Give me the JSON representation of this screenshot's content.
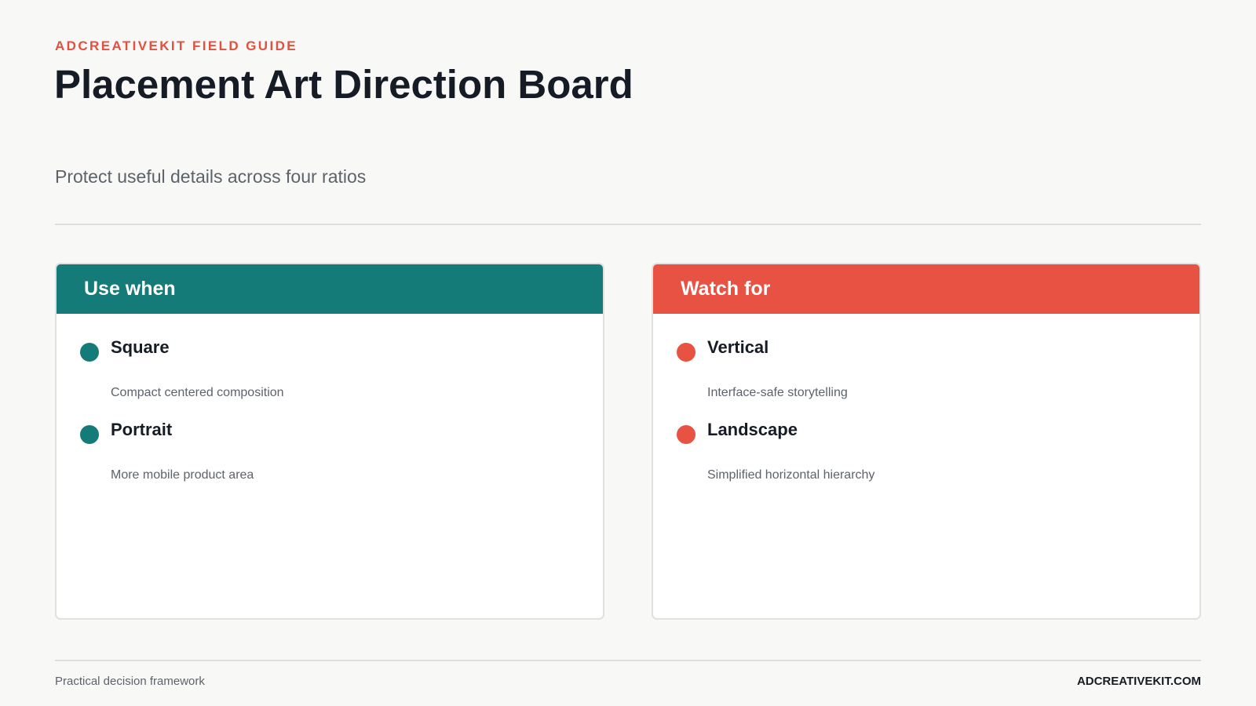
{
  "header": {
    "eyebrow": "ADCREATIVEKIT FIELD GUIDE",
    "title": "Placement Art Direction Board",
    "subtitle": "Protect useful details across four ratios"
  },
  "cards": [
    {
      "heading": "Use when",
      "accent_color": "#147b79",
      "items": [
        {
          "title": "Square",
          "description": "Compact centered composition"
        },
        {
          "title": "Portrait",
          "description": "More mobile product area"
        }
      ]
    },
    {
      "heading": "Watch for",
      "accent_color": "#e85242",
      "items": [
        {
          "title": "Vertical",
          "description": "Interface-safe storytelling"
        },
        {
          "title": "Landscape",
          "description": "Simplified horizontal hierarchy"
        }
      ]
    }
  ],
  "footer": {
    "left": "Practical decision framework",
    "right": "ADCREATIVEKIT.COM"
  },
  "colors": {
    "background": "#f8f8f6",
    "title_text": "#161c26",
    "muted_text": "#5d636b",
    "eyebrow": "#e2503f"
  }
}
